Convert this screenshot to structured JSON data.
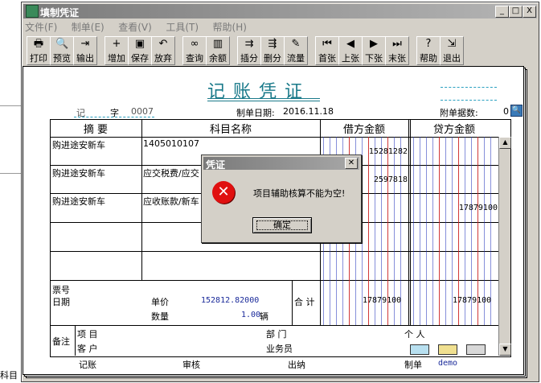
{
  "window": {
    "title": "填制凭证",
    "controls": [
      "_",
      "□",
      "X"
    ]
  },
  "menu": [
    "文件(F)",
    "制单(E)",
    "查看(V)",
    "工具(T)",
    "帮助(H)"
  ],
  "toolbar": [
    {
      "label": "打印",
      "icon": "printer-icon",
      "glyph": "🖶"
    },
    {
      "label": "预览",
      "icon": "preview-icon",
      "glyph": "🔍"
    },
    {
      "label": "输出",
      "icon": "export-icon",
      "glyph": "⇥"
    },
    {
      "label": "增加",
      "icon": "add-icon",
      "glyph": "+"
    },
    {
      "label": "保存",
      "icon": "save-icon",
      "glyph": "▣"
    },
    {
      "label": "放弃",
      "icon": "undo-icon",
      "glyph": "↶"
    },
    {
      "label": "查询",
      "icon": "binoculars-icon",
      "glyph": "∞"
    },
    {
      "label": "余额",
      "icon": "bar-chart-icon",
      "glyph": "▥"
    },
    {
      "label": "插分",
      "icon": "insert-row-icon",
      "glyph": "⇉"
    },
    {
      "label": "删分",
      "icon": "delete-row-icon",
      "glyph": "⇶"
    },
    {
      "label": "流量",
      "icon": "cashflow-icon",
      "glyph": "✎"
    },
    {
      "label": "首张",
      "icon": "first-icon",
      "glyph": "⏮"
    },
    {
      "label": "上张",
      "icon": "prev-icon",
      "glyph": "◀"
    },
    {
      "label": "下张",
      "icon": "next-icon",
      "glyph": "▶"
    },
    {
      "label": "末张",
      "icon": "last-icon",
      "glyph": "⏭"
    },
    {
      "label": "帮助",
      "icon": "help-icon",
      "glyph": "?"
    },
    {
      "label": "退出",
      "icon": "exit-icon",
      "glyph": "⇲"
    }
  ],
  "voucher": {
    "title": "记账凭证",
    "type_label": "记",
    "number_label": "字",
    "number": "0007",
    "date_label": "制单日期:",
    "date": "2016.11.18",
    "attachments_label": "附单据数:",
    "attachments": "0",
    "columns": {
      "summary": "摘 要",
      "account": "科目名称",
      "debit": "借方金额",
      "credit": "贷方金额"
    },
    "rows": [
      {
        "summary": "购进途安新车",
        "account": "1405010107",
        "debit": "15281282",
        "credit": ""
      },
      {
        "summary": "购进途安新车",
        "account": "应交税费/应交",
        "debit": "2597818",
        "credit": ""
      },
      {
        "summary": "购进途安新车",
        "account": "应收账款/新车",
        "debit": "",
        "credit": "17879100"
      },
      {
        "summary": "",
        "account": "",
        "debit": "",
        "credit": ""
      },
      {
        "summary": "",
        "account": "",
        "debit": "",
        "credit": ""
      }
    ],
    "footer": {
      "ticket_label": "票号",
      "date_label": "日期",
      "price_label": "单价",
      "price": "152812.82000",
      "qty_label": "数量",
      "qty": "1.00",
      "qty_unit": "辆",
      "total_label": "合 计",
      "debit_total": "17879100",
      "credit_total": "17879100"
    },
    "remarks": {
      "label": "备注",
      "item_label": "项 目",
      "dept_label": "部 门",
      "person_label": "个 人",
      "customer_label": "客 户",
      "salesman_label": "业务员"
    },
    "signatures": {
      "bookkeeping": "记账",
      "review": "审核",
      "cashier": "出纳",
      "maker_label": "制单",
      "maker": "demo"
    }
  },
  "dialog": {
    "title": "凭证",
    "message": "项目辅助核算不能为空!",
    "ok": "确定"
  },
  "background": {
    "label": "科目"
  },
  "colors": {
    "title_teal": "#1a7a8a",
    "amount_blue": "#1a2a9a",
    "grid_blue": "#2233bb",
    "grid_red": "#cc2222",
    "error_red": "#e01010"
  }
}
